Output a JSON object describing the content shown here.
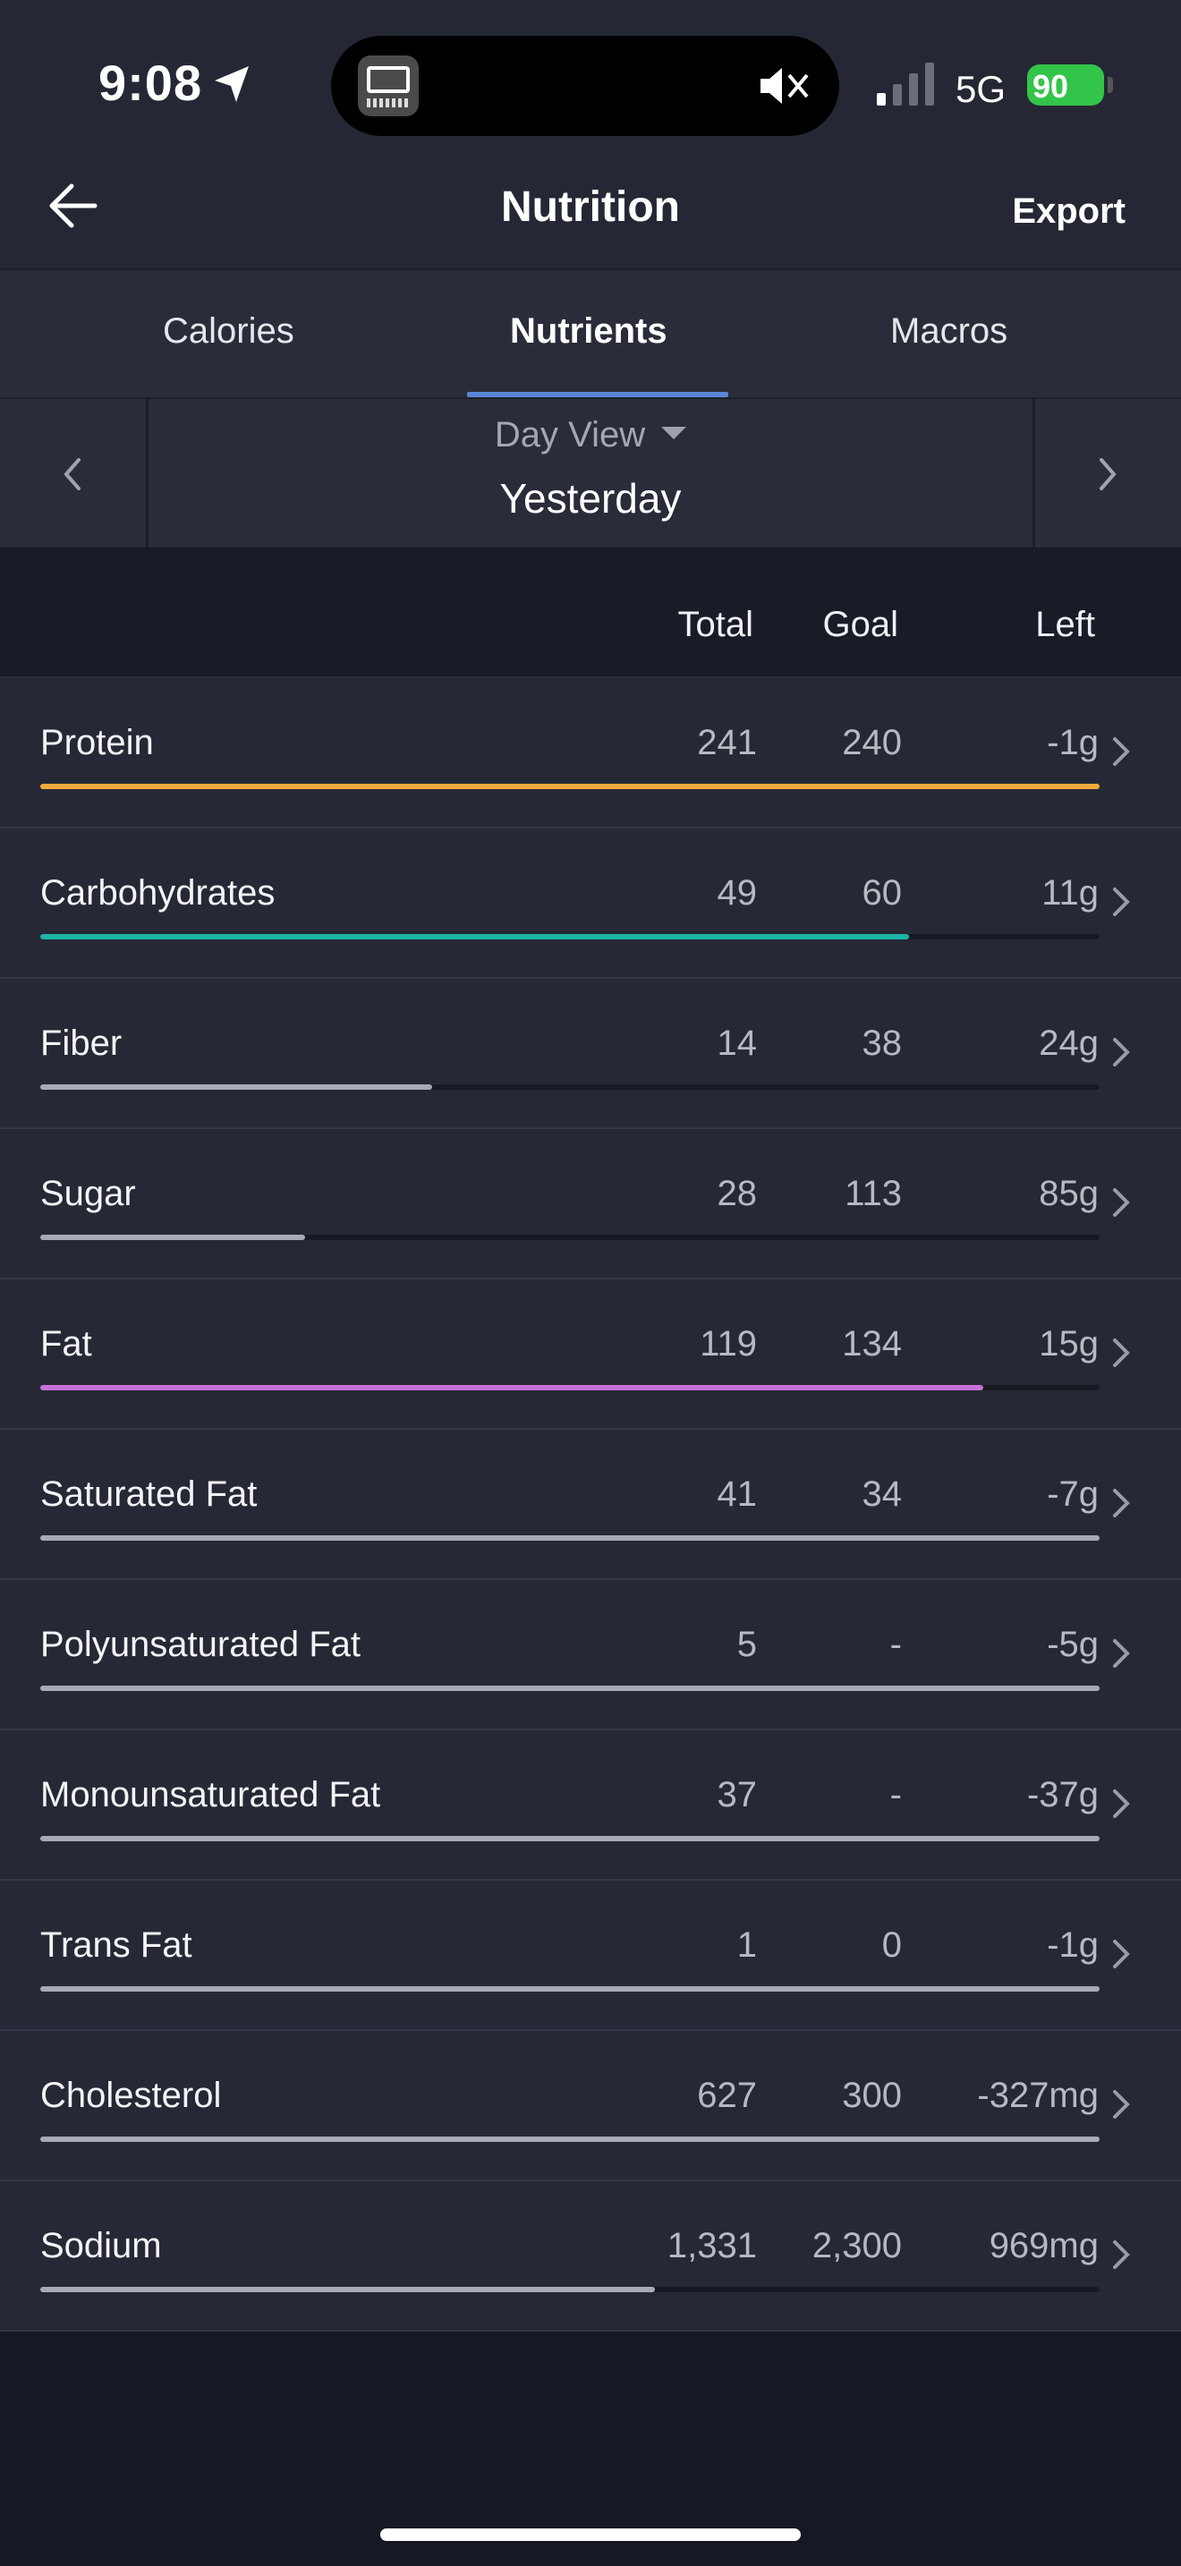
{
  "status_bar": {
    "time": "9:08",
    "network": "5G",
    "battery": "90",
    "icons": [
      "location-arrow-icon",
      "app-icon",
      "mute-icon",
      "bluetooth-icon",
      "signal-icon",
      "battery-icon"
    ]
  },
  "nav": {
    "title": "Nutrition",
    "export_label": "Export",
    "back_icon": "arrow-left-icon"
  },
  "tabs": [
    {
      "label": "Calories",
      "active": false
    },
    {
      "label": "Nutrients",
      "active": true
    },
    {
      "label": "Macros",
      "active": false
    }
  ],
  "date_selector": {
    "view_label": "Day View",
    "date_label": "Yesterday"
  },
  "table": {
    "headers": {
      "total": "Total",
      "goal": "Goal",
      "left": "Left"
    },
    "rows": [
      {
        "name": "Protein",
        "total": "241",
        "goal": "240",
        "left": "-1g",
        "progress": 1.0,
        "color": "#f2a93b"
      },
      {
        "name": "Carbohydrates",
        "total": "49",
        "goal": "60",
        "left": "11g",
        "progress": 0.82,
        "color": "#1bb5a6"
      },
      {
        "name": "Fiber",
        "total": "14",
        "goal": "38",
        "left": "24g",
        "progress": 0.37,
        "color": "#a9abb4"
      },
      {
        "name": "Sugar",
        "total": "28",
        "goal": "113",
        "left": "85g",
        "progress": 0.25,
        "color": "#a9abb4"
      },
      {
        "name": "Fat",
        "total": "119",
        "goal": "134",
        "left": "15g",
        "progress": 0.89,
        "color": "#c671d6"
      },
      {
        "name": "Saturated Fat",
        "total": "41",
        "goal": "34",
        "left": "-7g",
        "progress": 1.0,
        "color": "#a9abb4"
      },
      {
        "name": "Polyunsaturated Fat",
        "total": "5",
        "goal": "-",
        "left": "-5g",
        "progress": 1.0,
        "color": "#a9abb4"
      },
      {
        "name": "Monounsaturated Fat",
        "total": "37",
        "goal": "-",
        "left": "-37g",
        "progress": 1.0,
        "color": "#a9abb4"
      },
      {
        "name": "Trans Fat",
        "total": "1",
        "goal": "0",
        "left": "-1g",
        "progress": 1.0,
        "color": "#a9abb4"
      },
      {
        "name": "Cholesterol",
        "total": "627",
        "goal": "300",
        "left": "-327mg",
        "progress": 1.0,
        "color": "#a9abb4"
      },
      {
        "name": "Sodium",
        "total": "1,331",
        "goal": "2,300",
        "left": "969mg",
        "progress": 0.58,
        "color": "#a9abb4"
      }
    ]
  }
}
